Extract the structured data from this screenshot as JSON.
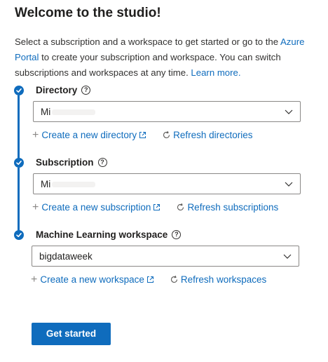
{
  "title": "Welcome to the studio!",
  "intro": {
    "text_before": "Select a subscription and a workspace to get started or go to the ",
    "portal_link": "Azure Portal",
    "text_after": " to create your subscription and workspace. You can switch subscriptions and workspaces at any time. ",
    "learn_more": "Learn more."
  },
  "steps": [
    {
      "title": "Directory",
      "value": "Mi",
      "create_label": "Create a new directory",
      "refresh_label": "Refresh directories"
    },
    {
      "title": "Subscription",
      "value": "Mi",
      "create_label": "Create a new subscription",
      "refresh_label": "Refresh subscriptions"
    },
    {
      "title": "Machine Learning workspace",
      "value": "bigdataweek",
      "create_label": "Create a new workspace",
      "refresh_label": "Refresh workspaces"
    }
  ],
  "primary_button": "Get started",
  "colors": {
    "accent": "#0f6cbd",
    "border": "#8a8886",
    "text": "#201f1e"
  },
  "icons": [
    "checkmark-icon",
    "help-circle-icon",
    "chevron-down-icon",
    "plus-icon",
    "open-external-icon",
    "refresh-icon"
  ]
}
